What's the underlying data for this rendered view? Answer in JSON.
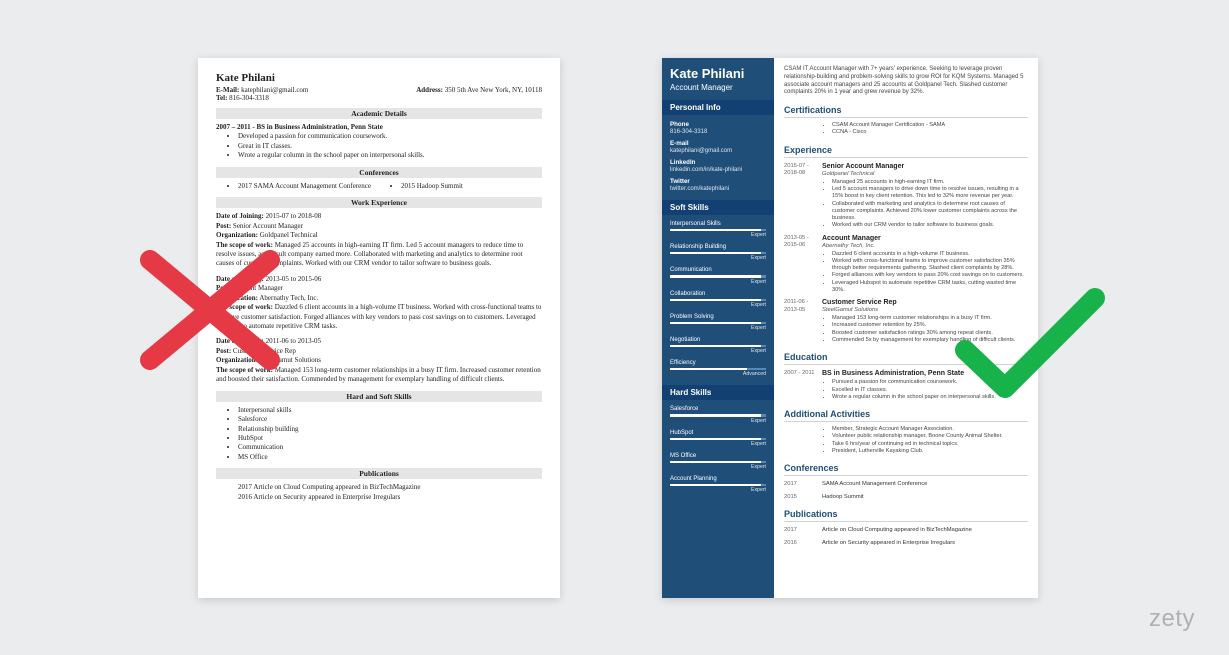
{
  "logo": "zety",
  "left": {
    "name": "Kate Philani",
    "email_label": "E-Mail:",
    "email": "katephilani@gmail.com",
    "address_label": "Address:",
    "address": "350 5th Ave New York, NY, 10118",
    "tel_label": "Tel:",
    "tel": "816-304-3318",
    "sections": {
      "academic": "Academic Details",
      "conferences": "Conferences",
      "work": "Work Experience",
      "skills": "Hard and Soft Skills",
      "pubs": "Publications"
    },
    "edu_line": "2007 – 2011 - BS in Business Administration, Penn State",
    "edu_bullets": [
      "Developed a passion for communication coursework.",
      "Great in IT classes.",
      "Wrote a regular column in the school paper on interpersonal skills."
    ],
    "conf_left": "2017 SAMA Account Management Conference",
    "conf_right": "2015 Hadoop Summit",
    "jobs": [
      {
        "doj_label": "Date of Joining:",
        "doj": " 2015-07 to 2018-08",
        "post_label": "Post:",
        "post": " Senior Account Manager",
        "org_label": "Organization:",
        "org": " Goldpanel Technical",
        "scope_label": "The scope of work:",
        "scope": " Managed 25 accounts in high-earning IT firm. Led 5 account managers to reduce time to resolve issues, as a result company earned more. Collaborated with marketing and analytics to determine root causes of customer complaints. Worked with our CRM vendor to tailor software to business goals."
      },
      {
        "doj_label": "Date of Joining:",
        "doj": " 2013-05 to 2015-06",
        "post_label": "Post:",
        "post": " Account Manager",
        "org_label": "Organization:",
        "org": " Abernathy Tech, Inc.",
        "scope_label": "The scope of work:",
        "scope": " Dazzled 6 client accounts in a high-volume IT business. Worked with cross-functional teams to improve customer satisfaction. Forged alliances with key vendors to pass cost savings on to customers. Leveraged Hubspot to automate repetitive CRM tasks."
      },
      {
        "doj_label": "Date of Joining:",
        "doj": " 2011-06 to 2013-05",
        "post_label": "Post:",
        "post": " Customer Service Rep",
        "org_label": "Organization:",
        "org": " SteelGamut Solutions",
        "scope_label": "The scope of work:",
        "scope": " Managed 153 long-term customer relationships in a busy IT firm. Increased customer retention and boosted their satisfaction. Commended by management for exemplary handling of difficult clients."
      }
    ],
    "skills": [
      "Interpersonal skills",
      "Salesforce",
      "Relationship building",
      "HubSpot",
      "Communication",
      "MS Office"
    ],
    "pubs": [
      "2017 Article on Cloud Computing appeared in BizTechMagazine",
      "2016 Article on Security appeared in Enterprise Irregulars"
    ]
  },
  "right": {
    "name": "Kate Philani",
    "title": "Account Manager",
    "side_sections": {
      "personal": "Personal Info",
      "soft": "Soft Skills",
      "hard": "Hard Skills"
    },
    "contact": [
      {
        "label": "Phone",
        "value": "816-304-3318"
      },
      {
        "label": "E-mail",
        "value": "katephilani@gmail.com"
      },
      {
        "label": "LinkedIn",
        "value": "linkedin.com/in/kate-philani"
      },
      {
        "label": "Twitter",
        "value": "twitter.com/katephilani"
      }
    ],
    "soft": [
      {
        "name": "Interpersonal Skills",
        "level": "Expert",
        "pct": 95
      },
      {
        "name": "Relationship Building",
        "level": "Expert",
        "pct": 95
      },
      {
        "name": "Communication",
        "level": "Expert",
        "pct": 95
      },
      {
        "name": "Collaboration",
        "level": "Expert",
        "pct": 95
      },
      {
        "name": "Problem Solving",
        "level": "Expert",
        "pct": 95
      },
      {
        "name": "Negotiation",
        "level": "Expert",
        "pct": 95
      },
      {
        "name": "Efficiency",
        "level": "Advanced",
        "pct": 80
      }
    ],
    "hard": [
      {
        "name": "Salesforce",
        "level": "Expert",
        "pct": 95
      },
      {
        "name": "HubSpot",
        "level": "Expert",
        "pct": 95
      },
      {
        "name": "MS Office",
        "level": "Expert",
        "pct": 95
      },
      {
        "name": "Account Planning",
        "level": "Expert",
        "pct": 95
      }
    ],
    "summary": "CSAM IT Account Manager with 7+ years' experience. Seeking to leverage proven relationship-building and problem-solving skills to grow ROI for KQM Systems. Managed 5 associate account managers and 25 accounts at Goldpanel Tech. Slashed customer complaints 20% in 1 year and grew revenue by 32%.",
    "sections": {
      "cert": "Certifications",
      "exp": "Experience",
      "edu": "Education",
      "act": "Additional Activities",
      "conf": "Conferences",
      "pub": "Publications"
    },
    "certs": [
      "CSAM Account Manager Certification - SAMA",
      "CCNA - Cisco"
    ],
    "exp": [
      {
        "dates": "2015-07 - 2018-08",
        "role": "Senior Account Manager",
        "org": "Goldpanel Technical",
        "bullets": [
          "Managed 25 accounts in high-earning IT firm.",
          "Led 5 account managers to drive down time to resolve issues, resulting in a 15% boost in key client retention. This led to 32% more revenue per year.",
          "Collaborated with marketing and analytics to determine root causes of customer complaints. Achieved 20% lower customer complaints across the business.",
          "Worked with our CRM vendor to tailor software to business goals."
        ]
      },
      {
        "dates": "2013-05 - 2015-06",
        "role": "Account Manager",
        "org": "Abernathy Tech, Inc.",
        "bullets": [
          "Dazzled 6 client accounts in a high-volume IT business.",
          "Worked with cross-functional teams to improve customer satisfaction 35% through better requirements gathering. Slashed client complaints by 28%.",
          "Forged alliances with key vendors to pass 20% cost savings on to customers.",
          "Leveraged Hubspot to automate repetitive CRM tasks, cutting wasted time 30%."
        ]
      },
      {
        "dates": "2011-06 - 2013-05",
        "role": "Customer Service Rep",
        "org": "SteelGamut Solutions",
        "bullets": [
          "Managed 153 long-term customer relationships in a busy IT firm.",
          "Increased customer retention by 25%.",
          "Boosted customer satisfaction ratings 30% among repeat clients.",
          "Commended 5x by management for exemplary handling of difficult clients."
        ]
      }
    ],
    "edu": {
      "dates": "2007 - 2011",
      "degree": "BS in Business Administration, Penn State",
      "bullets": [
        "Pursued a passion for communication coursework.",
        "Excelled in IT classes.",
        "Wrote a regular column in the school paper on interpersonal skills."
      ]
    },
    "activities": [
      "Member, Strategic Account Manager Association.",
      "Volunteer public relationship manager, Boone County Animal Shelter.",
      "Take 6 hrs/year of continuing ed in technical topics.",
      "President, Lutherville Kayaking Club."
    ],
    "confs": [
      {
        "year": "2017",
        "text": "SAMA Account Management Conference"
      },
      {
        "year": "2015",
        "text": "Hadoop Summit"
      }
    ],
    "pubs": [
      {
        "year": "2017",
        "text": "Article on Cloud Computing appeared in BizTechMagazine"
      },
      {
        "year": "2016",
        "text": "Article on Security appeared in Enterprise Irregulars"
      }
    ]
  }
}
